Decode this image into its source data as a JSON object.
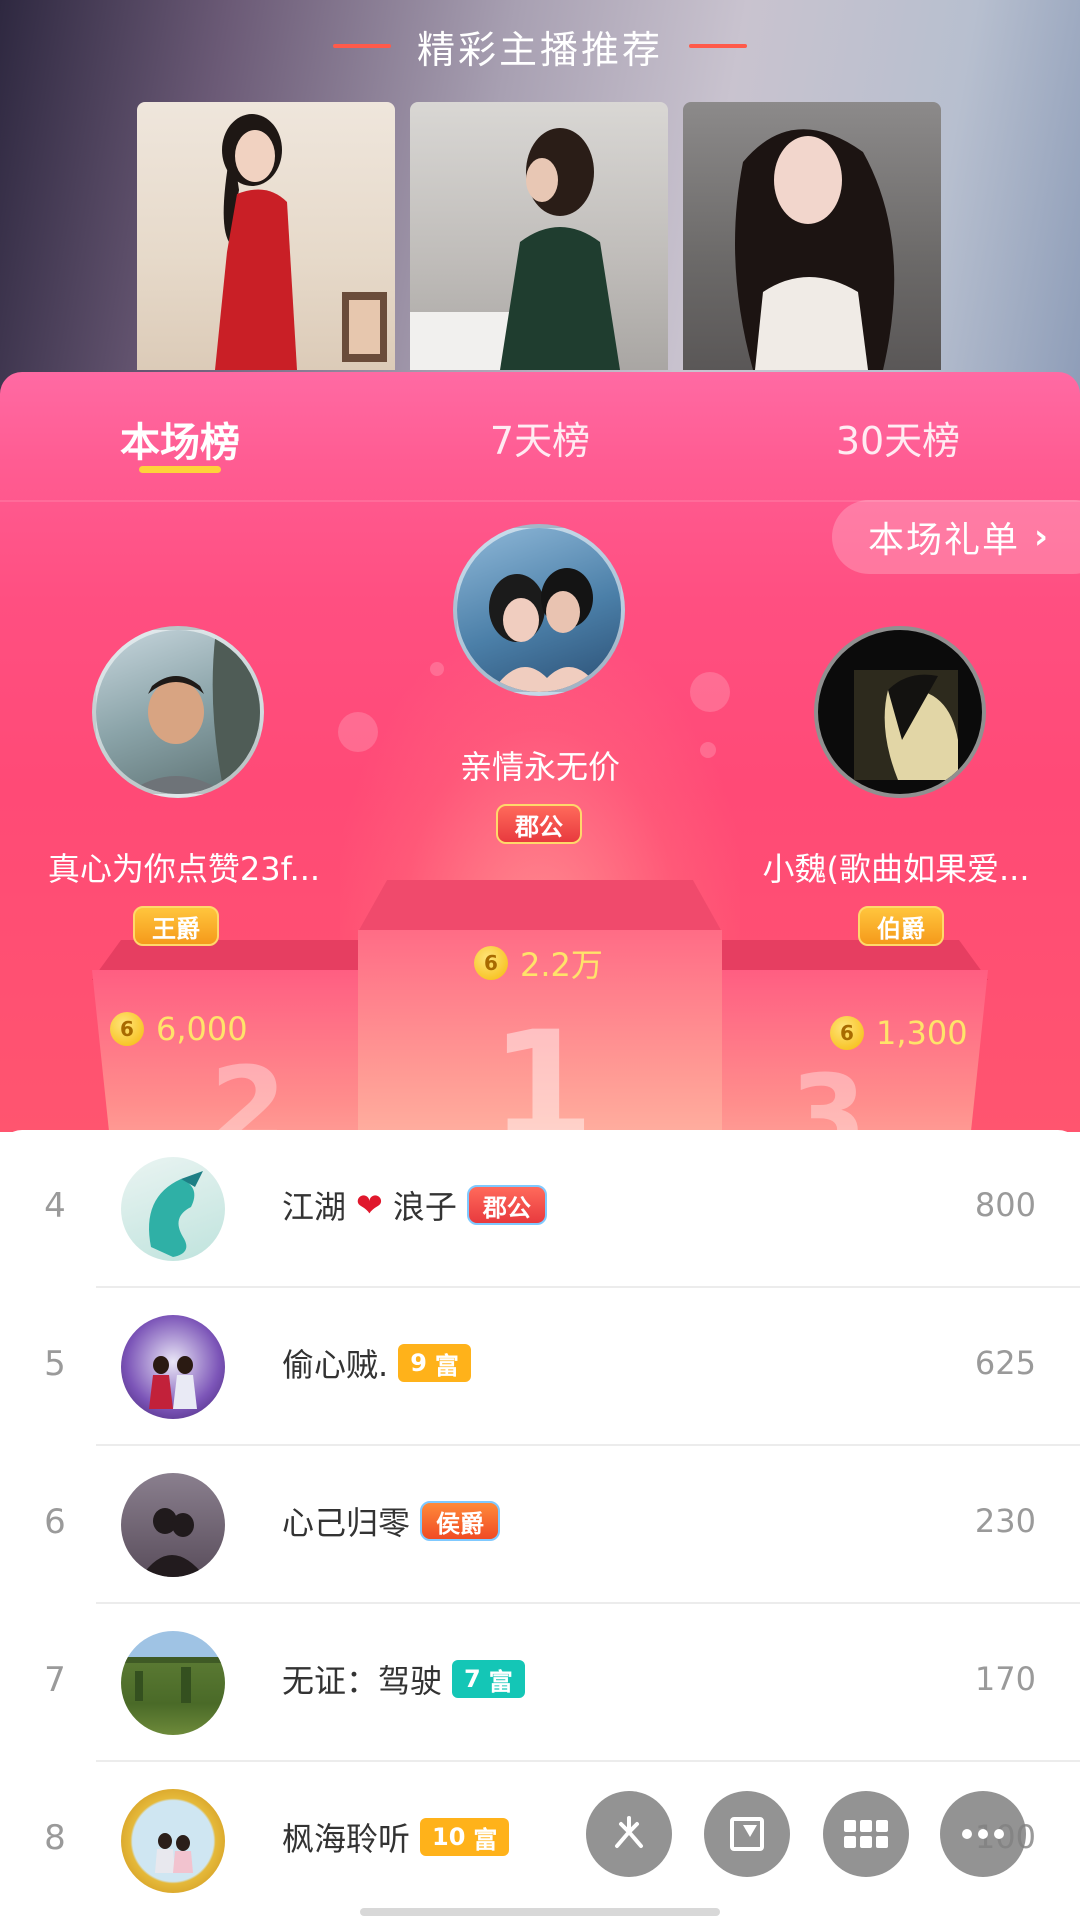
{
  "header": {
    "title": "精彩主播推荐"
  },
  "tabs": [
    {
      "label": "本场榜",
      "active": true
    },
    {
      "label": "7天榜",
      "active": false
    },
    {
      "label": "30天榜",
      "active": false
    }
  ],
  "gift_list_button": {
    "label": "本场礼单",
    "chevron": "›"
  },
  "podium": {
    "first": {
      "name": "亲情永无价",
      "badge": "郡公",
      "score": "2.2万",
      "number": "1"
    },
    "second": {
      "name": "真心为你点赞23f...",
      "badge": "王爵",
      "score": "6,000",
      "number": "2"
    },
    "third": {
      "name": "小魏(歌曲如果爱...",
      "badge": "伯爵",
      "score": "1,300",
      "number": "3"
    }
  },
  "coin_symbol": "6",
  "list": [
    {
      "rank": "4",
      "name_before": "江湖",
      "name_after": "浪子",
      "badge": "郡公",
      "score": "800"
    },
    {
      "rank": "5",
      "name": "偷心贼.",
      "wealth_level": "9",
      "wealth_label": "富",
      "score": "625"
    },
    {
      "rank": "6",
      "name": "心己归零",
      "badge": "侯爵",
      "score": "230"
    },
    {
      "rank": "7",
      "name": "无证：驾驶",
      "wealth_level": "7",
      "wealth_label": "富",
      "score": "170"
    },
    {
      "rank": "8",
      "name": "枫海聆听",
      "wealth_level": "10",
      "wealth_label": "富",
      "score": "100"
    }
  ],
  "colors": {
    "panel_pink": "#ff4f81",
    "tab_underline": "#ffd23a",
    "score_gold": "#ffe36a",
    "wealth_orange": "#ffb21a",
    "wealth_teal": "#14c6b6"
  }
}
